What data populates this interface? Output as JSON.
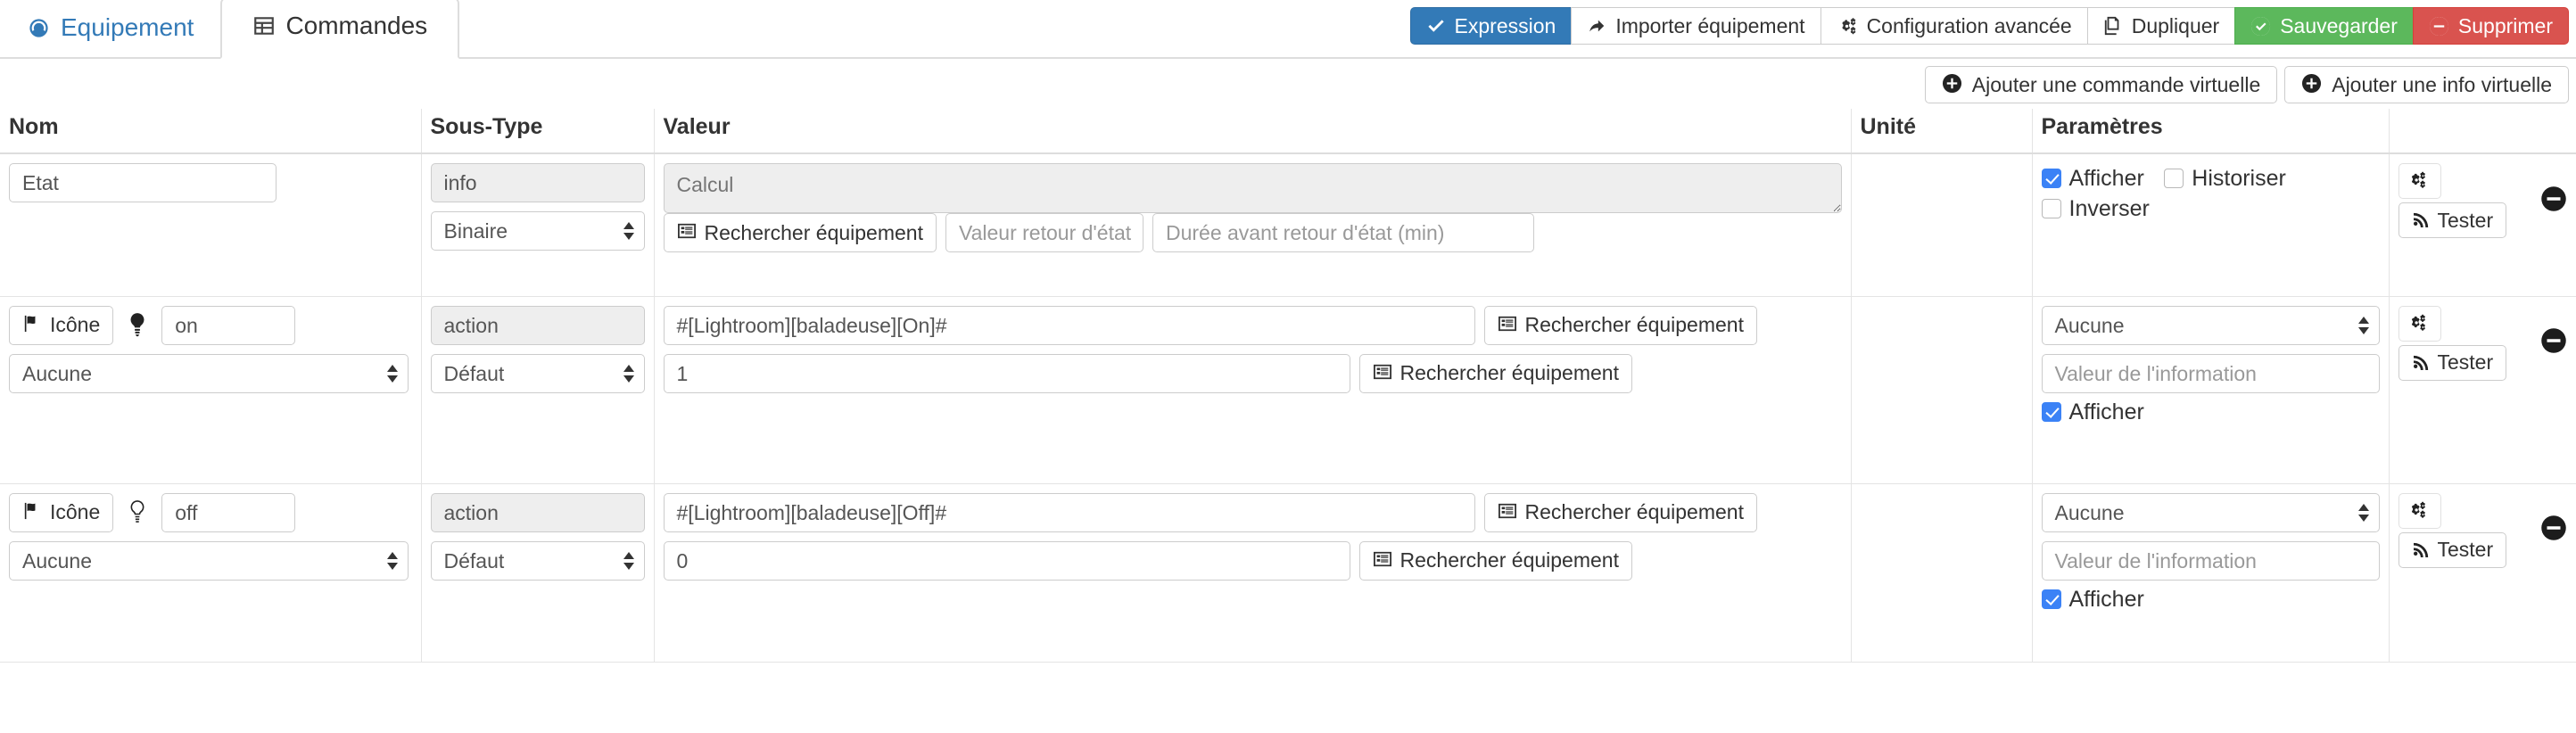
{
  "tabs": [
    {
      "label": "Equipement",
      "icon": "dashboard-icon",
      "active": false
    },
    {
      "label": "Commandes",
      "icon": "table-icon",
      "active": true
    }
  ],
  "toolbar": {
    "buttons": [
      {
        "label": "Expression",
        "icon": "check-icon",
        "style": "primary"
      },
      {
        "label": "Importer équipement",
        "icon": "share-icon",
        "style": "default"
      },
      {
        "label": "Configuration avancée",
        "icon": "cogs-icon",
        "style": "default"
      },
      {
        "label": "Dupliquer",
        "icon": "copy-icon",
        "style": "default"
      },
      {
        "label": "Sauvegarder",
        "icon": "check-circle-icon",
        "style": "success"
      },
      {
        "label": "Supprimer",
        "icon": "minus-circle-icon",
        "style": "danger"
      }
    ]
  },
  "addbar": {
    "add_command_label": "Ajouter une commande virtuelle",
    "add_info_label": "Ajouter une info virtuelle",
    "plus_icon": "plus-circle-icon"
  },
  "table": {
    "headers": {
      "nom": "Nom",
      "sous_type": "Sous-Type",
      "valeur": "Valeur",
      "unite": "Unité",
      "parametres": "Paramètres",
      "actions": ""
    },
    "rows": [
      {
        "id": "etat",
        "nom": {
          "value": "Etat"
        },
        "sous_type": {
          "type": "info",
          "subtype": "Binaire"
        },
        "valeur": {
          "calcul_placeholder": "Calcul",
          "calcul_value": "",
          "search_label": "Rechercher équipement",
          "retour_etat_placeholder": "Valeur retour d'état",
          "retour_etat_value": "",
          "duree_placeholder": "Durée avant retour d'état (min)",
          "duree_value": ""
        },
        "unite": "",
        "parametres": {
          "afficher_label": "Afficher",
          "afficher_checked": true,
          "historiser_label": "Historiser",
          "historiser_checked": false,
          "inverser_label": "Inverser",
          "inverser_checked": false
        },
        "actions": {
          "config_icon": "cogs-icon",
          "tester_label": "Tester",
          "tester_icon": "rss-icon",
          "remove_icon": "minus-circle-icon"
        }
      },
      {
        "id": "on",
        "nom": {
          "icon_button_label": "Icône",
          "icon_button_icon": "flag-icon",
          "preview_icon": "lightbulb-filled-icon",
          "value": "on",
          "select_value": "Aucune"
        },
        "sous_type": {
          "type": "action",
          "subtype": "Défaut"
        },
        "valeur": {
          "request_value": "#[Lightroom][baladeuse][On]#",
          "search_label": "Rechercher équipement",
          "second_value": "1",
          "search_label2": "Rechercher équipement"
        },
        "unite": "",
        "parametres": {
          "select_value": "Aucune",
          "info_placeholder": "Valeur de l'information",
          "info_value": "",
          "afficher_label": "Afficher",
          "afficher_checked": true
        },
        "actions": {
          "config_icon": "cogs-icon",
          "tester_label": "Tester",
          "tester_icon": "rss-icon",
          "remove_icon": "minus-circle-icon"
        }
      },
      {
        "id": "off",
        "nom": {
          "icon_button_label": "Icône",
          "icon_button_icon": "flag-icon",
          "preview_icon": "lightbulb-outline-icon",
          "value": "off",
          "select_value": "Aucune"
        },
        "sous_type": {
          "type": "action",
          "subtype": "Défaut"
        },
        "valeur": {
          "request_value": "#[Lightroom][baladeuse][Off]#",
          "search_label": "Rechercher équipement",
          "second_value": "0",
          "search_label2": "Rechercher équipement"
        },
        "unite": "",
        "parametres": {
          "select_value": "Aucune",
          "info_placeholder": "Valeur de l'information",
          "info_value": "",
          "afficher_label": "Afficher",
          "afficher_checked": true
        },
        "actions": {
          "config_icon": "cogs-icon",
          "tester_label": "Tester",
          "tester_icon": "rss-icon",
          "remove_icon": "minus-circle-icon"
        }
      }
    ]
  },
  "colors": {
    "primary": "#337ab7",
    "success": "#5cb85c",
    "danger": "#d9534f",
    "checkbox_on": "#3b82f6",
    "border": "#cccccc"
  }
}
